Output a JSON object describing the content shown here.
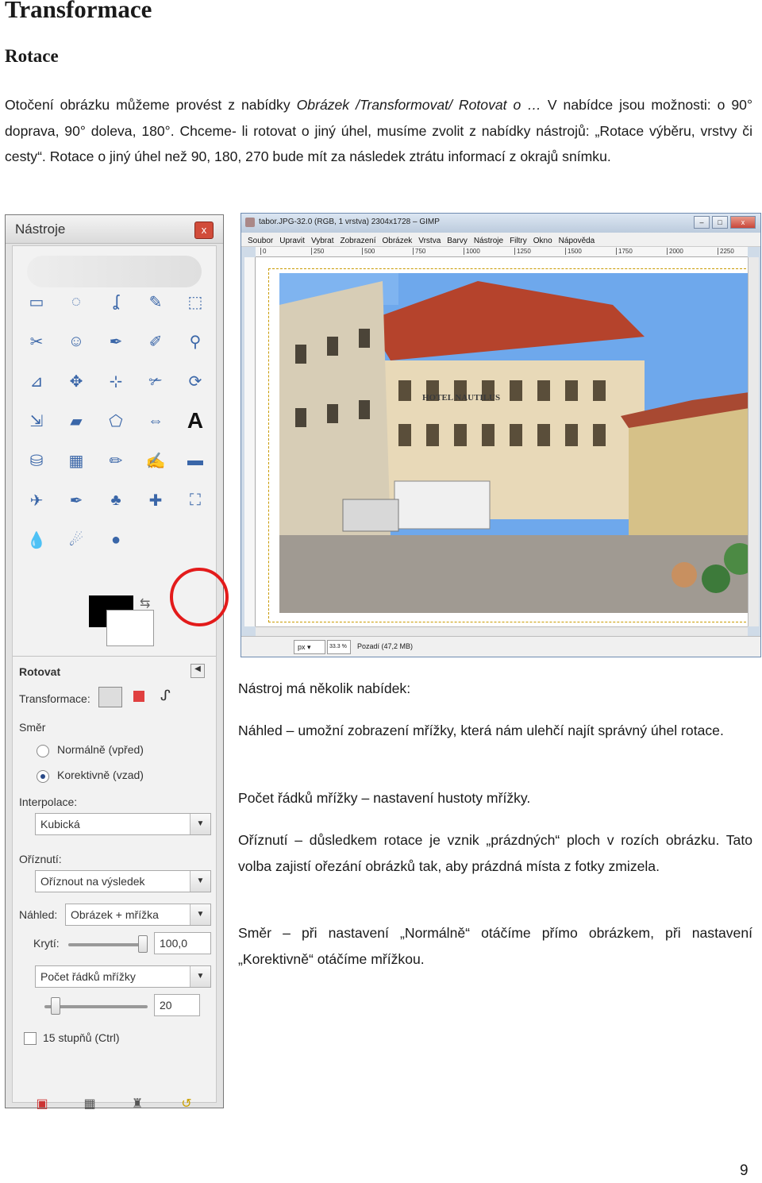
{
  "page": {
    "title": "Transformace",
    "subtitle": "Rotace",
    "intro_p1": "Otočení obrázku můžeme provést z nabídky ",
    "intro_menu": "Obrázek /Transformovat/ Rotovat o …",
    "intro_p2": " V nabídce jsou možnosti: o 90° doprava, 90° doleva, 180°. Chceme- li rotovat o jiný úhel, musíme zvolit z nabídky nástrojů: „Rotace výběru, vrstvy či cesty“. Rotace o jiný úhel než 90, 180, 270 bude mít za následek ztrátu informací z okrajů snímku.",
    "tool_intro": "Nástroj má několik nabídek:",
    "preview_text": "Náhled – umožní zobrazení mřížky, která nám ulehčí najít správný úhel rotace.",
    "grid_text": "Počet řádků mřížky – nastavení hustoty mřížky.",
    "clip_text": "Oříznutí – důsledkem rotace je vznik „prázdných“ ploch v rozích obrázku. Tato volba zajistí ořezání obrázků tak, aby prázdná místa z fotky zmizela.",
    "direction_text": "Směr – při nastavení „Normálně“ otáčíme přímo obrázkem, při nastavení „Korektivně“ otáčíme mřížkou.",
    "page_number": "9"
  },
  "toolbox": {
    "title": "Nástroje",
    "close": "x",
    "tool_name": "Rotovat",
    "transform_label": "Transformace:",
    "direction_label": "Směr",
    "radio_normal": "Normálně (vpřed)",
    "radio_corrective": "Korektivně (vzad)",
    "interpolation_label": "Interpolace:",
    "interpolation_value": "Kubická",
    "clip_label": "Oříznutí:",
    "clip_value": "Oříznout na výsledek",
    "preview_label": "Náhled:",
    "preview_value": "Obrázek + mřížka",
    "opacity_label": "Krytí:",
    "opacity_value": "100,0",
    "grid_mode_value": "Počet řádků mřížky",
    "grid_lines_value": "20",
    "constrain_label": "15 stupňů  (Ctrl)",
    "tools": [
      "rect-select",
      "ellipse-select",
      "free-select",
      "fuzzy-select",
      "color-select",
      "scissors-select",
      "foreground-select",
      "paths",
      "color-picker",
      "zoom",
      "measure",
      "move",
      "align",
      "crop",
      "rotate",
      "scale",
      "shear",
      "perspective",
      "flip",
      "text",
      "bucket-fill",
      "blend",
      "pencil",
      "paintbrush",
      "eraser",
      "airbrush",
      "ink",
      "clone",
      "heal",
      "perspective-clone",
      "blur",
      "smudge",
      "dodge-burn"
    ],
    "tool_icons": [
      "▭",
      "◌",
      "ʆ",
      "✎",
      "⬚",
      "✂",
      "☺",
      "✒",
      "✐",
      "⚲",
      "⊿",
      "✥",
      "⊹",
      "✃",
      "⟳",
      "⇲",
      "▰",
      "⬠",
      "⇔",
      "A",
      "⛁",
      "▦",
      "✏",
      "✍",
      "▬",
      "✈",
      "✒",
      "♣",
      "✚",
      "⛶",
      "💧",
      "☄",
      "●"
    ]
  },
  "gimp": {
    "title": "tabor.JPG-32.0 (RGB, 1 vrstva) 2304x1728 – GIMP",
    "menu": [
      "Soubor",
      "Upravit",
      "Vybrat",
      "Zobrazení",
      "Obrázek",
      "Vrstva",
      "Barvy",
      "Nástroje",
      "Filtry",
      "Okno",
      "Nápověda"
    ],
    "ruler_ticks": [
      "0",
      "250",
      "500",
      "750",
      "1000",
      "1250",
      "1500",
      "1750",
      "2000",
      "2250"
    ],
    "unit": "px ▾",
    "zoom": "33.3 %",
    "status": "Pozadí (47,2 MB)",
    "hotel_sign": "HOTEL NAUTILUS"
  }
}
